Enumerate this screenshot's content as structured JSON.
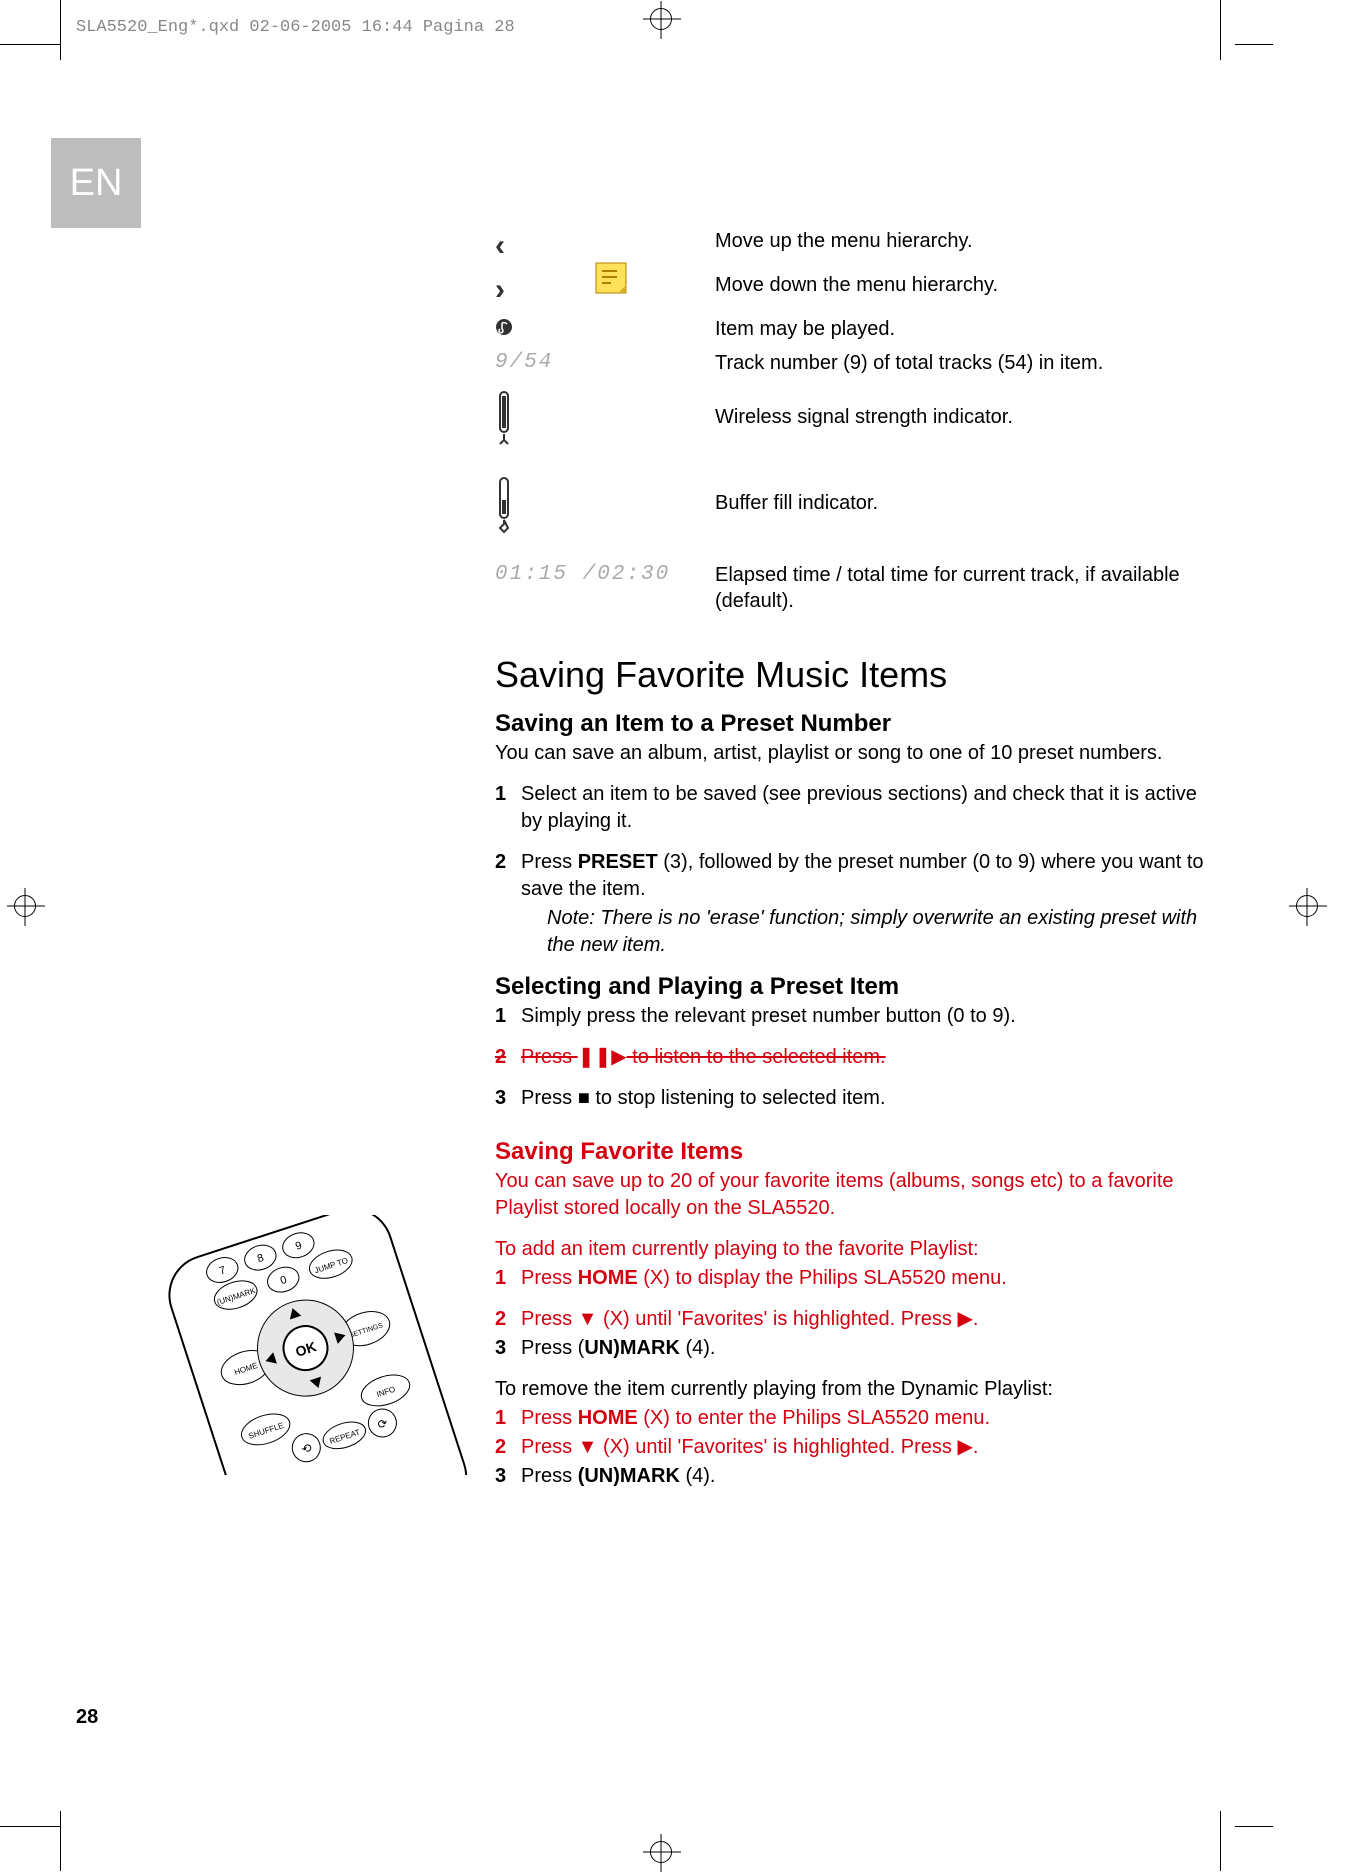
{
  "header": "SLA5520_Eng*.qxd  02-06-2005  16:44  Pagina 28",
  "lang_badge": "EN",
  "page_number": "28",
  "legend": {
    "rows": [
      {
        "icon_name": "chevron-left-icon",
        "desc": "Move up the menu hierarchy."
      },
      {
        "icon_name": "chevron-right-icon",
        "desc": "Move down the menu hierarchy."
      },
      {
        "icon_name": "music-note-icon",
        "desc": "Item may be played."
      },
      {
        "icon_name": "track-count",
        "label": "9/54",
        "desc": "Track number (9) of total tracks (54) in item."
      },
      {
        "icon_name": "signal-indicator-icon",
        "desc": "Wireless signal strength indicator."
      },
      {
        "icon_name": "buffer-indicator-icon",
        "desc": "Buffer fill indicator."
      },
      {
        "icon_name": "elapsed-time",
        "label": "01:15 /02:30",
        "desc": "Elapsed time / total time for current track, if available (default)."
      }
    ]
  },
  "section_title": "Saving Favorite Music Items",
  "sub1": {
    "title": "Saving an Item to a Preset Number",
    "intro": "You can save an album, artist, playlist or song to one of 10 preset numbers.",
    "step1": "Select an item to be saved (see previous sections) and check that it is active by playing it.",
    "step2_pre": "Press ",
    "step2_bold": "PRESET",
    "step2_post": " (3), followed by the preset number (0 to 9) where you want to save the item.",
    "note": "Note: There is no 'erase' function; simply overwrite an existing preset with the new item."
  },
  "sub2": {
    "title": "Selecting and Playing a Preset Item",
    "step1": "Simply press the relevant preset number button (0 to 9).",
    "step2_pre": "Press ",
    "step2_post": " to listen to the selected item.",
    "step3_pre": "Press ",
    "step3_post": " to stop listening to selected item."
  },
  "sub3": {
    "title": "Saving Favorite Items",
    "intro": "You can save up to 20 of your favorite items (albums, songs etc) to a favorite Playlist stored locally on the SLA5520.",
    "add_intro": "To add an item currently playing to the favorite Playlist:",
    "add1_pre": "Press ",
    "add1_bold": "HOME",
    "add1_post": " (X) to display the Philips SLA5520 menu.",
    "add2": "Press ▼ (X) until 'Favorites' is highlighted. Press ▶.",
    "add3_pre": "Press (",
    "add3_bold": "UN)MARK",
    "add3_post": " (4).",
    "rem_intro": "To remove the item currently playing from the Dynamic Playlist:",
    "rem1_pre": "Press ",
    "rem1_bold": "HOME",
    "rem1_post": " (X) to enter the Philips SLA5520 menu.",
    "rem2": "Press ▼ (X) until 'Favorites' is highlighted. Press ▶.",
    "rem3_pre": "Press ",
    "rem3_bold": "(UN)MARK",
    "rem3_post": " (4)."
  },
  "nums": {
    "one": "1",
    "two": "2",
    "three": "3"
  }
}
